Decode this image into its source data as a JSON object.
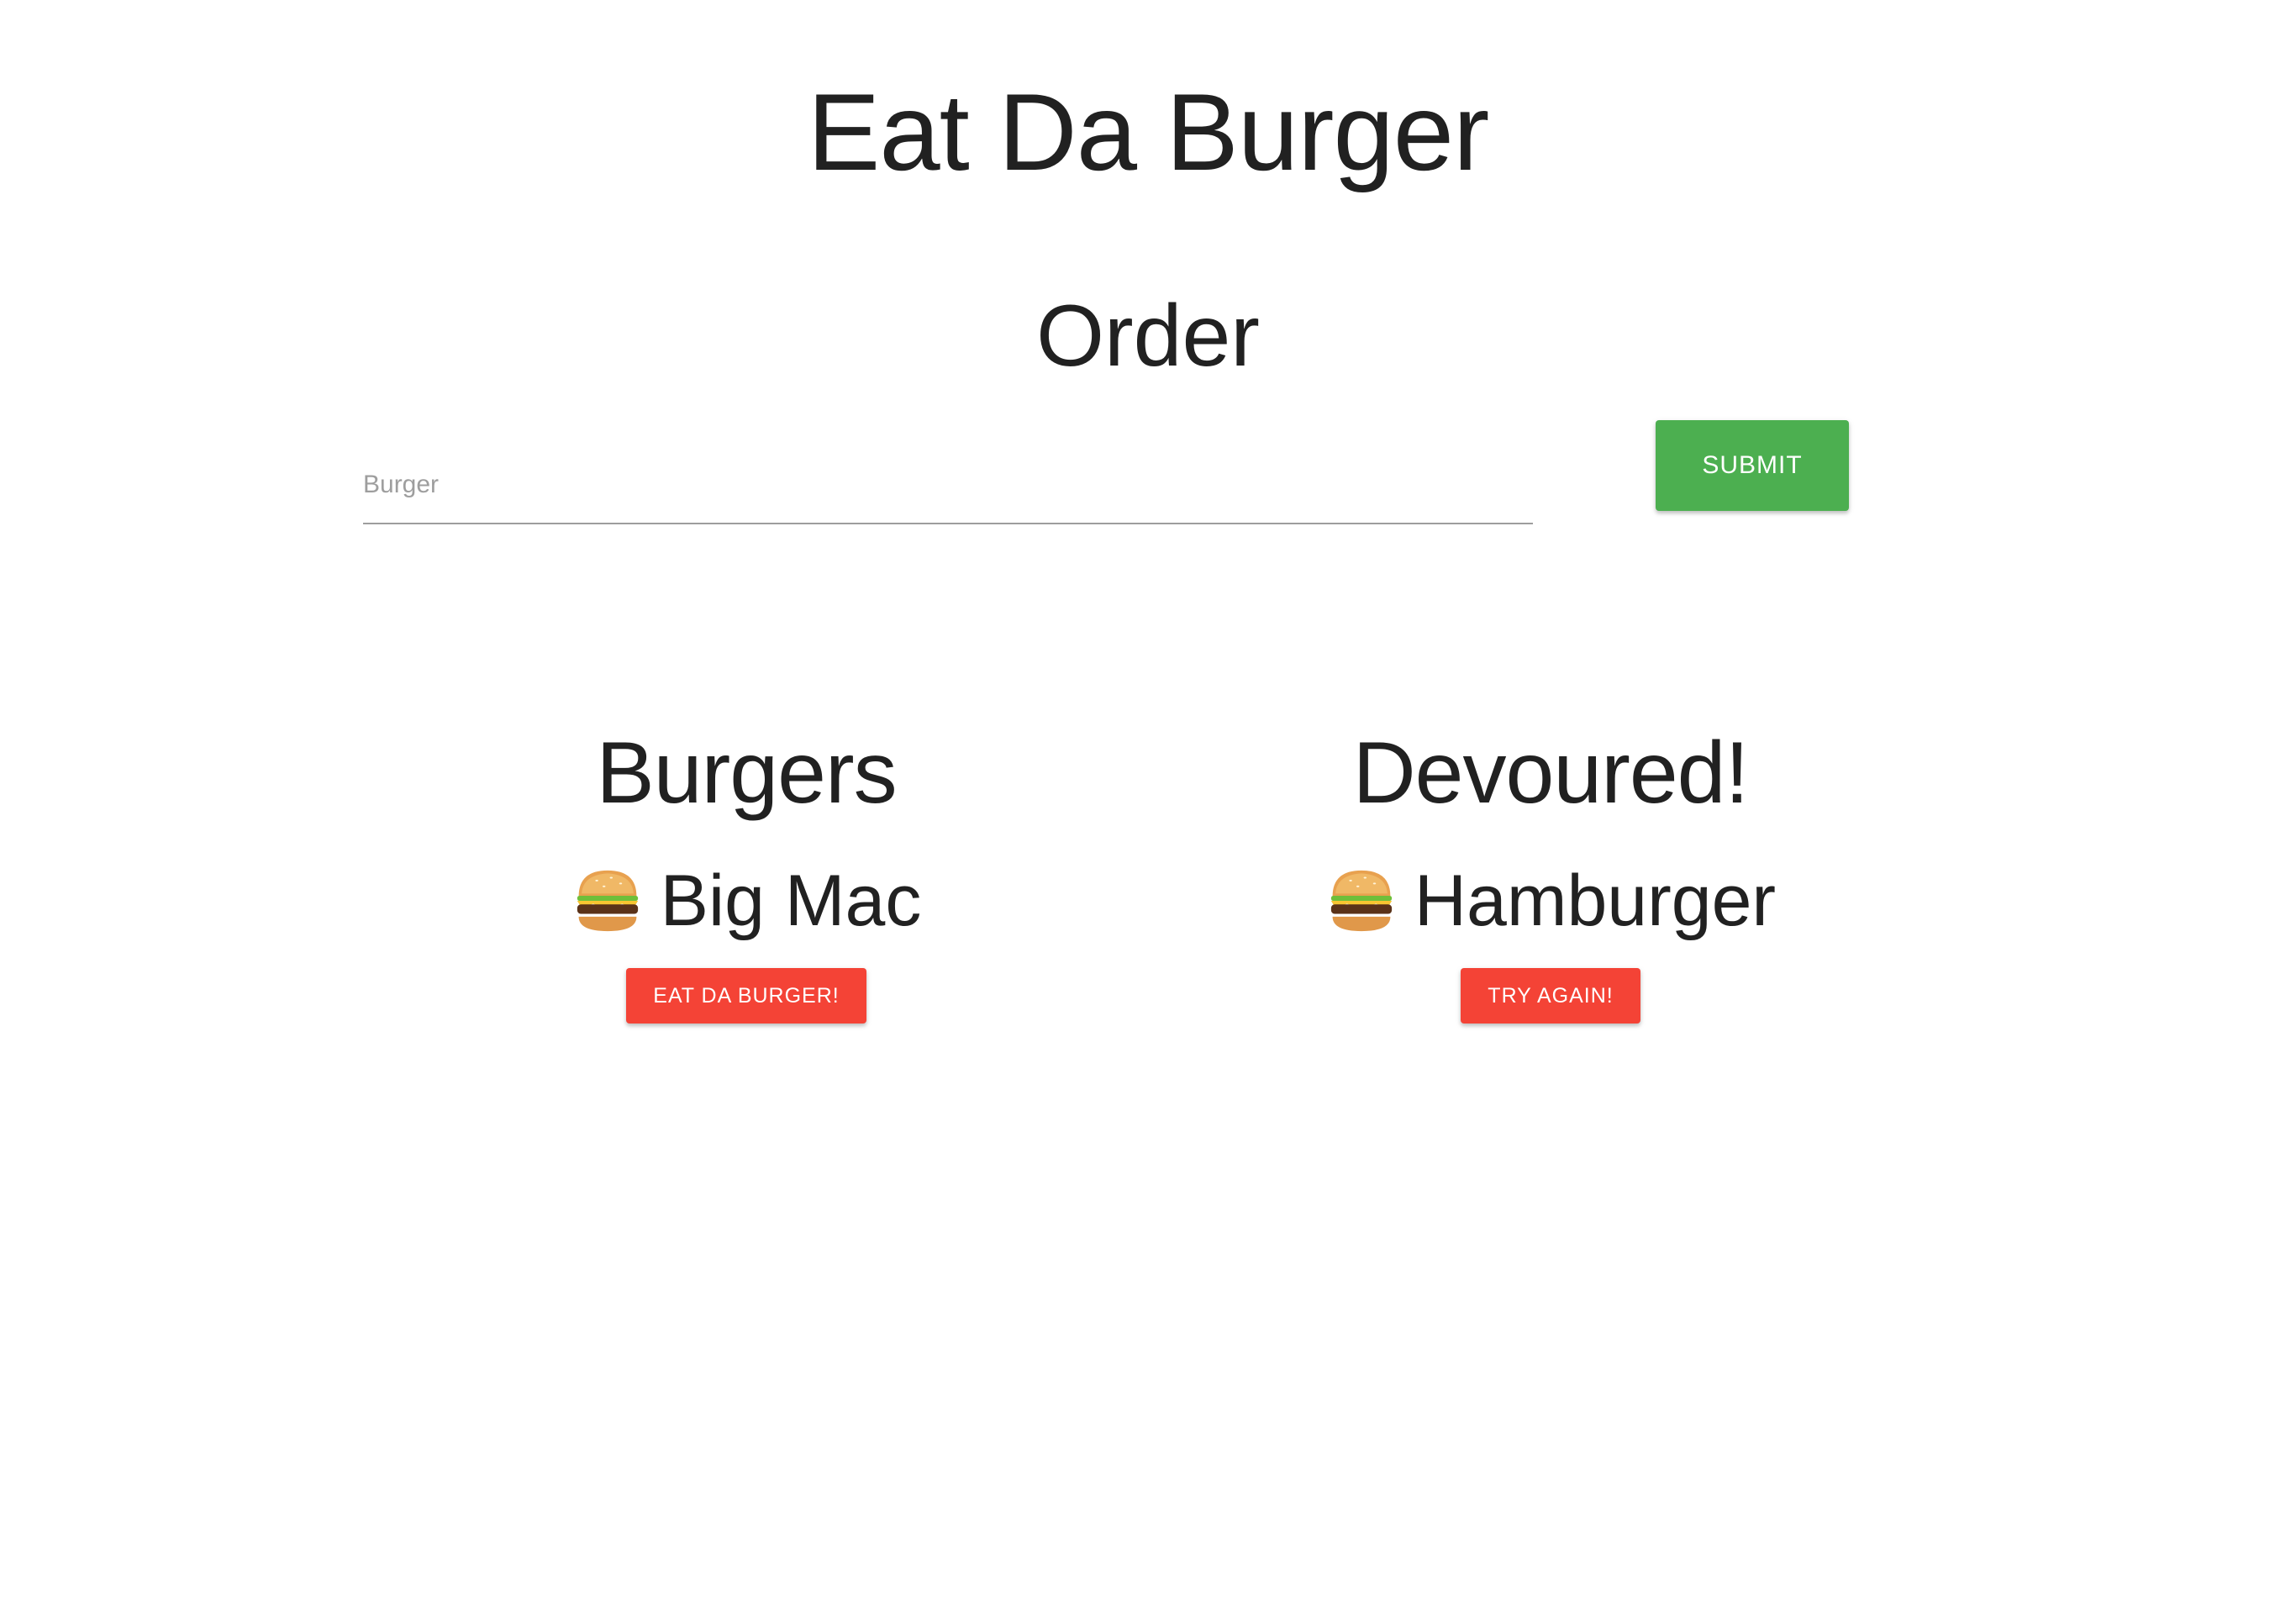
{
  "header": {
    "title": "Eat Da Burger"
  },
  "order": {
    "heading": "Order",
    "input_value": "",
    "input_placeholder": "Burger",
    "submit_label": "SUBMIT",
    "submit_color": "#4caf50"
  },
  "burgers": {
    "heading": "Burgers",
    "items": [
      {
        "icon": "hamburger-icon",
        "name": "Big Mac",
        "button_label": "EAT DA BURGER!"
      }
    ]
  },
  "devoured": {
    "heading": "Devoured!",
    "items": [
      {
        "icon": "hamburger-icon",
        "name": "Hamburger",
        "button_label": "TRY AGAIN!"
      }
    ]
  },
  "colors": {
    "action_button": "#f44336",
    "text": "#212121"
  }
}
